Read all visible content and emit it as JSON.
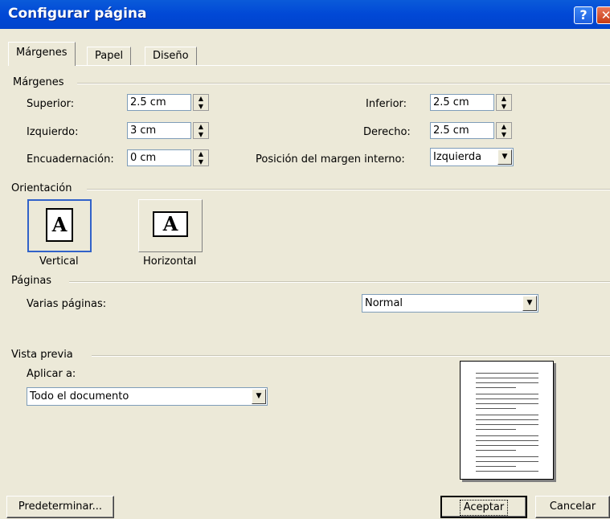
{
  "window": {
    "title": "Configurar página"
  },
  "tabs": [
    {
      "label": "Márgenes",
      "active": true
    },
    {
      "label": "Papel"
    },
    {
      "label": "Diseño"
    }
  ],
  "margins": {
    "group_label": "Márgenes",
    "superior": {
      "label": "Superior:",
      "value": "2.5 cm"
    },
    "izquierdo": {
      "label": "Izquierdo:",
      "value": "3 cm"
    },
    "encuadernacion": {
      "label": "Encuadernación:",
      "value": "0 cm"
    },
    "inferior": {
      "label": "Inferior:",
      "value": "2.5 cm"
    },
    "derecho": {
      "label": "Derecho:",
      "value": "2.5 cm"
    },
    "posicion": {
      "label": "Posición del margen interno:",
      "value": "Izquierda"
    }
  },
  "orientation": {
    "group_label": "Orientación",
    "vertical_label": "Vertical",
    "horizontal_label": "Horizontal",
    "page_letter": "A",
    "selected": "vertical"
  },
  "pages": {
    "group_label": "Páginas",
    "varias_label": "Varias páginas:",
    "varias_value": "Normal"
  },
  "preview": {
    "group_label": "Vista previa",
    "aplicar_label": "Aplicar a:",
    "aplicar_value": "Todo el documento"
  },
  "buttons": {
    "default_label": "Predeterminar...",
    "ok_label": "Aceptar",
    "cancel_label": "Cancelar"
  },
  "colors": {
    "titlebar": "#0148d6",
    "face": "#ece9d8",
    "field_border": "#7f9db9",
    "selection_border": "#3162c9"
  },
  "icons": {
    "help": "help-icon",
    "close": "close-icon",
    "spin_up": "up-arrow-icon",
    "spin_down": "down-arrow-icon",
    "dropdown": "chevron-down-icon"
  }
}
